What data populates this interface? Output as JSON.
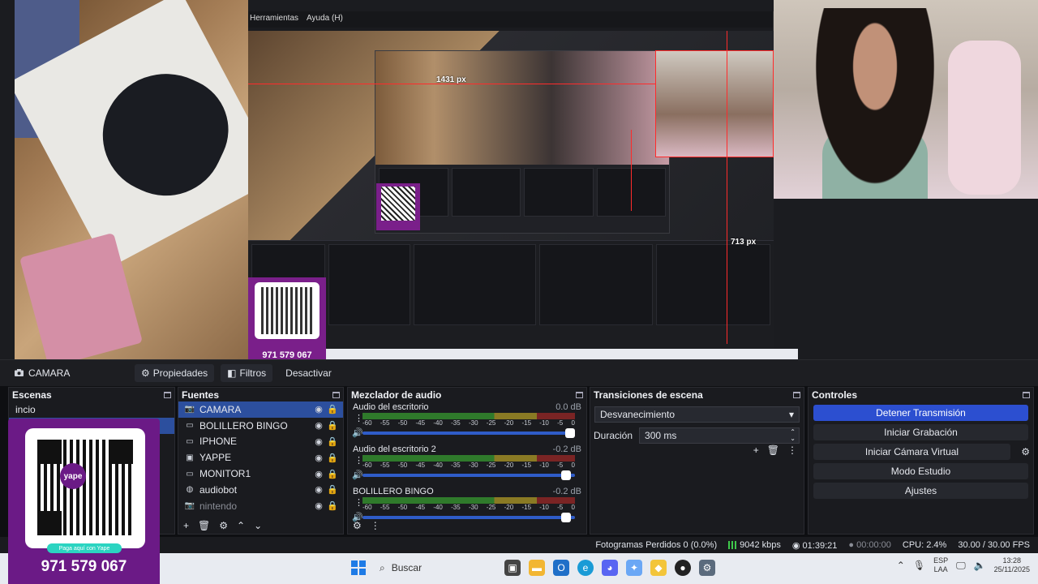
{
  "preview": {
    "nested_menu": [
      "Herramientas",
      "Ayuda (H)"
    ],
    "measure_left": "1431 px",
    "measure_right": "713 px",
    "nested_phone": "971 579 067"
  },
  "source_bar": {
    "current_source": "CAMARA",
    "properties": "Propiedades",
    "filters": "Filtros",
    "deactivate": "Desactivar"
  },
  "scenes": {
    "title": "Escenas",
    "items": [
      "incio"
    ]
  },
  "sources": {
    "title": "Fuentes",
    "items": [
      {
        "label": "CAMARA",
        "icon": "camera-icon"
      },
      {
        "label": "BOLILLERO BINGO",
        "icon": "monitor-icon"
      },
      {
        "label": "IPHONE",
        "icon": "monitor-icon"
      },
      {
        "label": "YAPPE",
        "icon": "image-icon"
      },
      {
        "label": "MONITOR1",
        "icon": "monitor-icon"
      },
      {
        "label": "audiobot",
        "icon": "globe-icon"
      },
      {
        "label": "nintendo",
        "icon": "camera-icon"
      }
    ]
  },
  "mixer": {
    "title": "Mezclador de audio",
    "ticks": [
      "-60",
      "-55",
      "-50",
      "-45",
      "-40",
      "-35",
      "-30",
      "-25",
      "-20",
      "-15",
      "-10",
      "-5",
      "0"
    ],
    "channels": [
      {
        "name": "Audio del escritorio",
        "db": "0.0 dB",
        "volume": 1.0
      },
      {
        "name": "Audio del escritorio 2",
        "db": "-0.2 dB",
        "volume": 0.98
      },
      {
        "name": "BOLILLERO BINGO",
        "db": "-0.2 dB",
        "volume": 0.98
      }
    ]
  },
  "transitions": {
    "title": "Transiciones de escena",
    "selected": "Desvanecimiento",
    "duration_label": "Duración",
    "duration_value": "300 ms"
  },
  "controls": {
    "title": "Controles",
    "stop_stream": "Detener Transmisión",
    "start_recording": "Iniciar Grabación",
    "start_virtual_cam": "Iniciar Cámara Virtual",
    "studio_mode": "Modo Estudio",
    "settings": "Ajustes"
  },
  "status": {
    "dropped_frames": "Fotogramas Perdidos 0 (0.0%)",
    "bitrate": "9042 kbps",
    "stream_time": "01:39:21",
    "rec_time": "00:00:00",
    "cpu": "CPU: 2.4%",
    "fps": "30.00 / 30.00 FPS"
  },
  "taskbar": {
    "search_placeholder": "Buscar",
    "lang_top": "ESP",
    "lang_bottom": "LAA",
    "time": "13:28",
    "date": "25/11/2025"
  },
  "qr_overlay": {
    "logo": "yape",
    "pill": "Paga aquí con Yape",
    "phone": "971 579 067"
  },
  "colors": {
    "accent_blue": "#2c4fd0",
    "selected_row": "#2c4f9e",
    "qr_purple": "#6b1a86",
    "meter_green": "#2f7a2b",
    "meter_yellow": "#8a7a24",
    "meter_red": "#7a2424"
  }
}
